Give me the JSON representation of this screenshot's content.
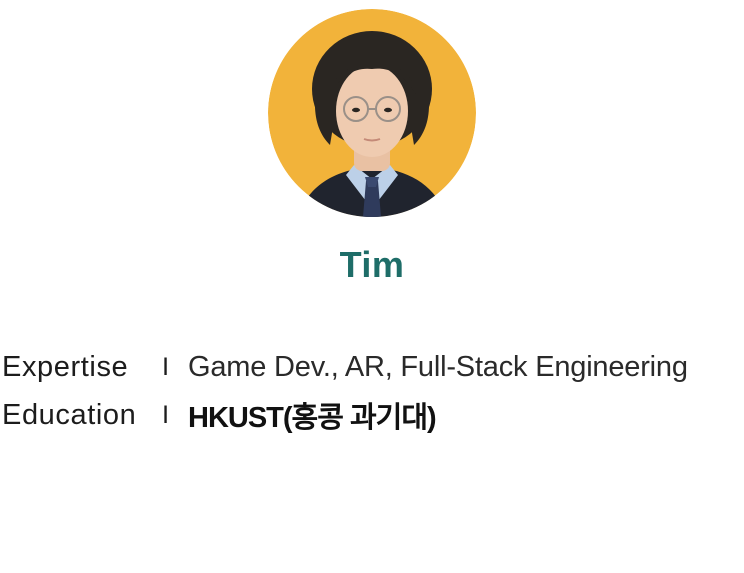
{
  "profile": {
    "name": "Tim",
    "avatar_icon": "profile-photo",
    "colors": {
      "avatar_background": "#f2b33a",
      "name": "#1e6d68"
    }
  },
  "details": [
    {
      "label": "Expertise",
      "separator": "I",
      "value": "Game Dev., AR, Full-Stack Engineering"
    },
    {
      "label": "Education",
      "separator": "I",
      "value": "HKUST(홍콩 과기대)"
    }
  ]
}
